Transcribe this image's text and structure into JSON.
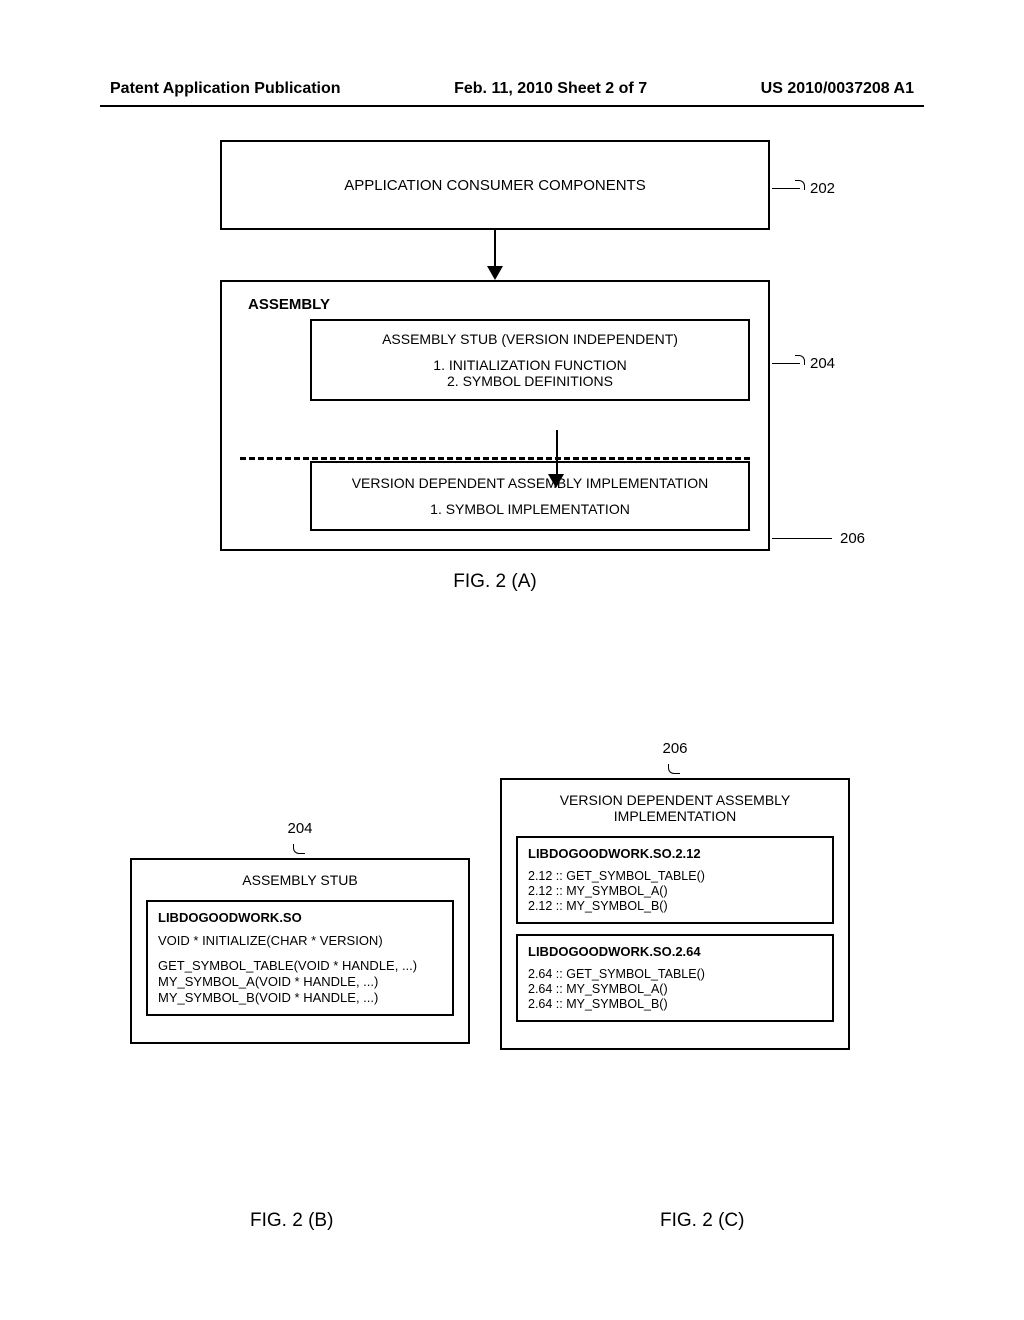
{
  "header": {
    "left": "Patent Application Publication",
    "center": "Feb. 11, 2010  Sheet 2 of 7",
    "right": "US 2010/0037208 A1"
  },
  "figA": {
    "consumer": "APPLICATION CONSUMER COMPONENTS",
    "ref202": "202",
    "assemblyTitle": "ASSEMBLY",
    "stubTitle": "ASSEMBLY STUB (VERSION INDEPENDENT)",
    "stubLine1": "1. INITIALIZATION FUNCTION",
    "stubLine2": "2. SYMBOL DEFINITIONS",
    "ref204": "204",
    "implTitle": "VERSION DEPENDENT ASSEMBLY IMPLEMENTATION",
    "implLine1": "1. SYMBOL IMPLEMENTATION",
    "ref206": "206",
    "caption": "FIG. 2 (A)"
  },
  "figB": {
    "ref": "204",
    "outerTitle": "ASSEMBLY STUB",
    "libTitle": "LIBDOGOODWORK.SO",
    "line1": "VOID * INITIALIZE(CHAR * VERSION)",
    "line2": "GET_SYMBOL_TABLE(VOID * HANDLE, ...)",
    "line3": "MY_SYMBOL_A(VOID * HANDLE, ...)",
    "line4": "MY_SYMBOL_B(VOID * HANDLE, ...)",
    "caption": "FIG. 2 (B)"
  },
  "figC": {
    "ref": "206",
    "outerTitle": "VERSION DEPENDENT ASSEMBLY IMPLEMENTATION",
    "lib1Title": "LIBDOGOODWORK.SO.2.12",
    "lib1Line1": "2.12 :: GET_SYMBOL_TABLE()",
    "lib1Line2": "2.12 :: MY_SYMBOL_A()",
    "lib1Line3": "2.12 :: MY_SYMBOL_B()",
    "lib2Title": "LIBDOGOODWORK.SO.2.64",
    "lib2Line1": "2.64 :: GET_SYMBOL_TABLE()",
    "lib2Line2": "2.64 :: MY_SYMBOL_A()",
    "lib2Line3": "2.64 :: MY_SYMBOL_B()",
    "caption": "FIG. 2 (C)"
  }
}
